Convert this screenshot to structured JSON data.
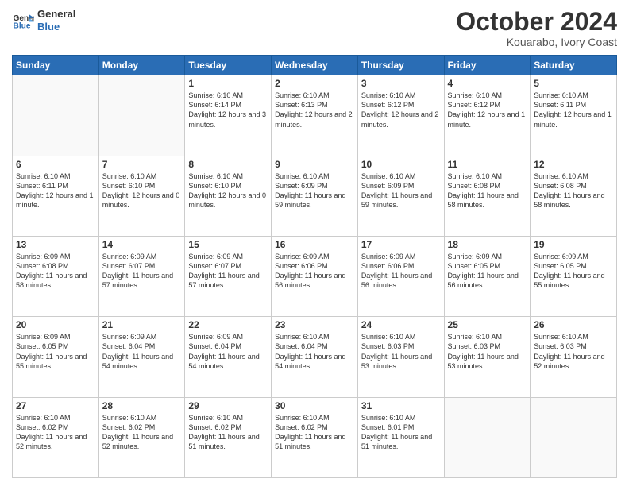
{
  "logo": {
    "line1": "General",
    "line2": "Blue"
  },
  "header": {
    "month": "October 2024",
    "location": "Kouarabo, Ivory Coast"
  },
  "weekdays": [
    "Sunday",
    "Monday",
    "Tuesday",
    "Wednesday",
    "Thursday",
    "Friday",
    "Saturday"
  ],
  "weeks": [
    [
      {
        "day": "",
        "info": ""
      },
      {
        "day": "",
        "info": ""
      },
      {
        "day": "1",
        "info": "Sunrise: 6:10 AM\nSunset: 6:14 PM\nDaylight: 12 hours\nand 3 minutes."
      },
      {
        "day": "2",
        "info": "Sunrise: 6:10 AM\nSunset: 6:13 PM\nDaylight: 12 hours\nand 2 minutes."
      },
      {
        "day": "3",
        "info": "Sunrise: 6:10 AM\nSunset: 6:12 PM\nDaylight: 12 hours\nand 2 minutes."
      },
      {
        "day": "4",
        "info": "Sunrise: 6:10 AM\nSunset: 6:12 PM\nDaylight: 12 hours\nand 1 minute."
      },
      {
        "day": "5",
        "info": "Sunrise: 6:10 AM\nSunset: 6:11 PM\nDaylight: 12 hours\nand 1 minute."
      }
    ],
    [
      {
        "day": "6",
        "info": "Sunrise: 6:10 AM\nSunset: 6:11 PM\nDaylight: 12 hours\nand 1 minute."
      },
      {
        "day": "7",
        "info": "Sunrise: 6:10 AM\nSunset: 6:10 PM\nDaylight: 12 hours\nand 0 minutes."
      },
      {
        "day": "8",
        "info": "Sunrise: 6:10 AM\nSunset: 6:10 PM\nDaylight: 12 hours\nand 0 minutes."
      },
      {
        "day": "9",
        "info": "Sunrise: 6:10 AM\nSunset: 6:09 PM\nDaylight: 11 hours\nand 59 minutes."
      },
      {
        "day": "10",
        "info": "Sunrise: 6:10 AM\nSunset: 6:09 PM\nDaylight: 11 hours\nand 59 minutes."
      },
      {
        "day": "11",
        "info": "Sunrise: 6:10 AM\nSunset: 6:08 PM\nDaylight: 11 hours\nand 58 minutes."
      },
      {
        "day": "12",
        "info": "Sunrise: 6:10 AM\nSunset: 6:08 PM\nDaylight: 11 hours\nand 58 minutes."
      }
    ],
    [
      {
        "day": "13",
        "info": "Sunrise: 6:09 AM\nSunset: 6:08 PM\nDaylight: 11 hours\nand 58 minutes."
      },
      {
        "day": "14",
        "info": "Sunrise: 6:09 AM\nSunset: 6:07 PM\nDaylight: 11 hours\nand 57 minutes."
      },
      {
        "day": "15",
        "info": "Sunrise: 6:09 AM\nSunset: 6:07 PM\nDaylight: 11 hours\nand 57 minutes."
      },
      {
        "day": "16",
        "info": "Sunrise: 6:09 AM\nSunset: 6:06 PM\nDaylight: 11 hours\nand 56 minutes."
      },
      {
        "day": "17",
        "info": "Sunrise: 6:09 AM\nSunset: 6:06 PM\nDaylight: 11 hours\nand 56 minutes."
      },
      {
        "day": "18",
        "info": "Sunrise: 6:09 AM\nSunset: 6:05 PM\nDaylight: 11 hours\nand 56 minutes."
      },
      {
        "day": "19",
        "info": "Sunrise: 6:09 AM\nSunset: 6:05 PM\nDaylight: 11 hours\nand 55 minutes."
      }
    ],
    [
      {
        "day": "20",
        "info": "Sunrise: 6:09 AM\nSunset: 6:05 PM\nDaylight: 11 hours\nand 55 minutes."
      },
      {
        "day": "21",
        "info": "Sunrise: 6:09 AM\nSunset: 6:04 PM\nDaylight: 11 hours\nand 54 minutes."
      },
      {
        "day": "22",
        "info": "Sunrise: 6:09 AM\nSunset: 6:04 PM\nDaylight: 11 hours\nand 54 minutes."
      },
      {
        "day": "23",
        "info": "Sunrise: 6:10 AM\nSunset: 6:04 PM\nDaylight: 11 hours\nand 54 minutes."
      },
      {
        "day": "24",
        "info": "Sunrise: 6:10 AM\nSunset: 6:03 PM\nDaylight: 11 hours\nand 53 minutes."
      },
      {
        "day": "25",
        "info": "Sunrise: 6:10 AM\nSunset: 6:03 PM\nDaylight: 11 hours\nand 53 minutes."
      },
      {
        "day": "26",
        "info": "Sunrise: 6:10 AM\nSunset: 6:03 PM\nDaylight: 11 hours\nand 52 minutes."
      }
    ],
    [
      {
        "day": "27",
        "info": "Sunrise: 6:10 AM\nSunset: 6:02 PM\nDaylight: 11 hours\nand 52 minutes."
      },
      {
        "day": "28",
        "info": "Sunrise: 6:10 AM\nSunset: 6:02 PM\nDaylight: 11 hours\nand 52 minutes."
      },
      {
        "day": "29",
        "info": "Sunrise: 6:10 AM\nSunset: 6:02 PM\nDaylight: 11 hours\nand 51 minutes."
      },
      {
        "day": "30",
        "info": "Sunrise: 6:10 AM\nSunset: 6:02 PM\nDaylight: 11 hours\nand 51 minutes."
      },
      {
        "day": "31",
        "info": "Sunrise: 6:10 AM\nSunset: 6:01 PM\nDaylight: 11 hours\nand 51 minutes."
      },
      {
        "day": "",
        "info": ""
      },
      {
        "day": "",
        "info": ""
      }
    ]
  ]
}
